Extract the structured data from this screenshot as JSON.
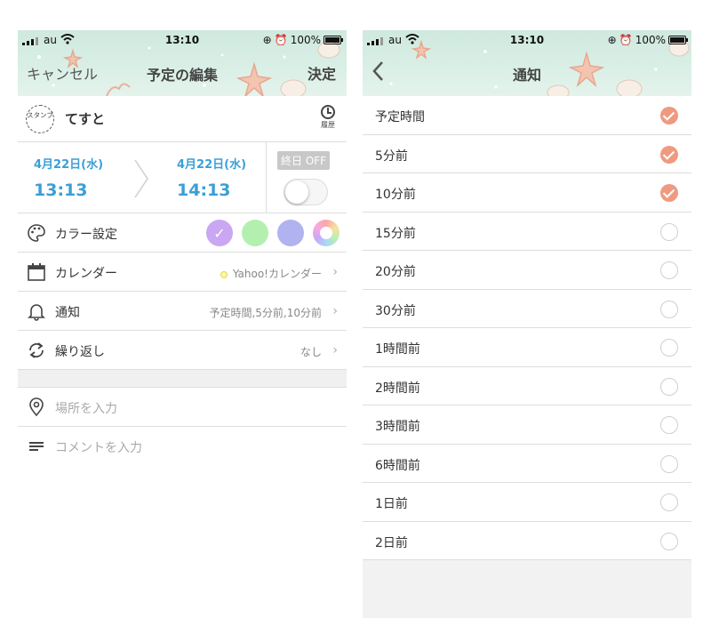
{
  "status_bar": {
    "carrier": "au",
    "time": "13:10",
    "battery": "100%"
  },
  "edit_screen": {
    "nav": {
      "cancel": "キャンセル",
      "title": "予定の編集",
      "confirm": "決定"
    },
    "stamp_label": "スタンプ",
    "event_title": "てすと",
    "history_label": "履歴",
    "start": {
      "date": "4月22日(水)",
      "time": "13:13"
    },
    "end": {
      "date": "4月22日(水)",
      "time": "14:13"
    },
    "allday_label": "終日 OFF",
    "color": {
      "label": "カラー設定",
      "selected_color": "#c9a7f2",
      "options": [
        "#c9a7f2",
        "#b3f0b0",
        "#b0b3f0",
        "rainbow"
      ]
    },
    "calendar": {
      "label": "カレンダー",
      "value": "Yahoo!カレンダー",
      "dot_color": "#fff7a8"
    },
    "notification": {
      "label": "通知",
      "value": "予定時間,5分前,10分前"
    },
    "repeat": {
      "label": "繰り返し",
      "value": "なし"
    },
    "location_placeholder": "場所を入力",
    "comment_placeholder": "コメントを入力"
  },
  "notify_screen": {
    "title": "通知",
    "accent_color": "#ef9a80",
    "options": [
      {
        "label": "予定時間",
        "checked": true
      },
      {
        "label": "5分前",
        "checked": true
      },
      {
        "label": "10分前",
        "checked": true
      },
      {
        "label": "15分前",
        "checked": false
      },
      {
        "label": "20分前",
        "checked": false
      },
      {
        "label": "30分前",
        "checked": false
      },
      {
        "label": "1時間前",
        "checked": false
      },
      {
        "label": "2時間前",
        "checked": false
      },
      {
        "label": "3時間前",
        "checked": false
      },
      {
        "label": "6時間前",
        "checked": false
      },
      {
        "label": "1日前",
        "checked": false
      },
      {
        "label": "2日前",
        "checked": false
      }
    ]
  }
}
